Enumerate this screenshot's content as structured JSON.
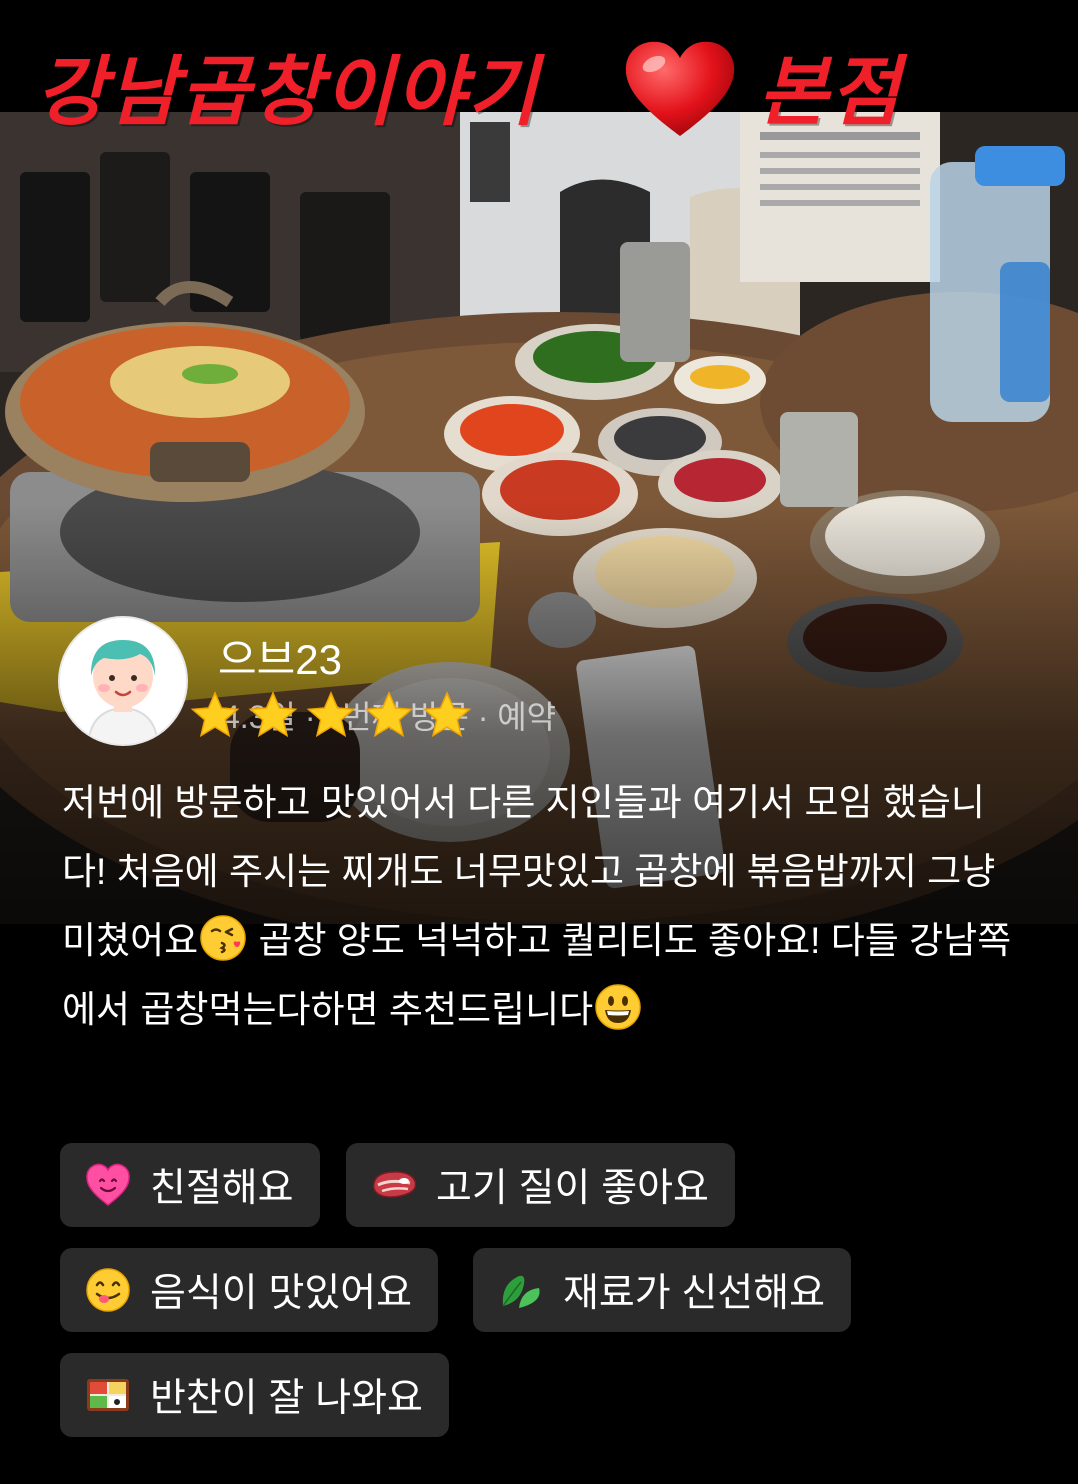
{
  "header": {
    "title": "강남곱창이야기",
    "heart_icon": "red-heart-icon",
    "branch": "본점",
    "color": "#f0202a"
  },
  "photo": {
    "description_icon": "food-photo"
  },
  "reviewer": {
    "name": "으브23",
    "meta": "4.3일 · 2번째 방문 · 예약",
    "rating": 5,
    "star_color": "#ffcf1f"
  },
  "review": {
    "text_part1": "저번에 방문하고 맛있어서 다른 지인들과 여기서 모임 했습니다! 처음에 주시는 찌개도 너무맛있고 곱창에 볶음밥까지 그냥 미쳤어요",
    "emoji1": "kissing-face-icon",
    "text_part2": " 곱창 양도 넉넉하고 퀄리티도 좋아요! 다들 강남쪽에서 곱창먹는다하면 추천드립니다",
    "emoji2": "grinning-face-icon"
  },
  "tags": [
    {
      "label": "친절해요",
      "icon": "smiling-heart-icon"
    },
    {
      "label": "고기 질이 좋아요",
      "icon": "meat-icon"
    },
    {
      "label": "음식이 맛있어요",
      "icon": "yum-face-icon"
    },
    {
      "label": "재료가 신선해요",
      "icon": "leaf-icon"
    },
    {
      "label": "반찬이 잘 나와요",
      "icon": "bento-icon"
    }
  ]
}
